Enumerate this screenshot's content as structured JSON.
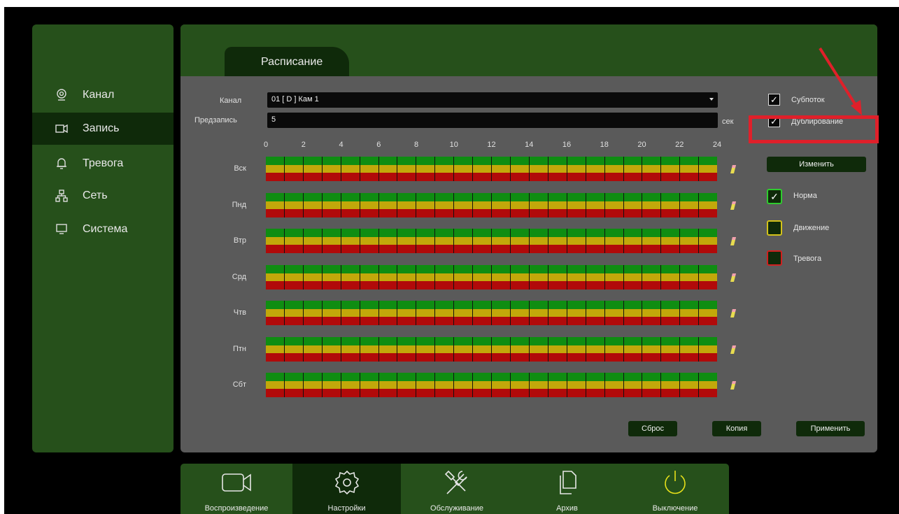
{
  "sidebar": {
    "items": [
      {
        "label": "Канал",
        "icon": "camera-lens-icon"
      },
      {
        "label": "Запись",
        "icon": "video-camera-icon",
        "active": true
      },
      {
        "label": "Тревога",
        "icon": "bell-icon"
      },
      {
        "label": "Сеть",
        "icon": "network-icon"
      },
      {
        "label": "Система",
        "icon": "monitor-icon"
      }
    ]
  },
  "tab": {
    "label": "Расписание"
  },
  "form": {
    "channel_label": "Канал",
    "channel_value": "01 [ D ] Кам 1",
    "prerecord_label": "Предзапись",
    "prerecord_value": "5",
    "prerecord_unit": "сек"
  },
  "schedule": {
    "hours": [
      "0",
      "2",
      "4",
      "6",
      "8",
      "10",
      "12",
      "14",
      "16",
      "18",
      "20",
      "22",
      "24"
    ],
    "days": [
      "Вск",
      "Пнд",
      "Втр",
      "Срд",
      "Чтв",
      "Птн",
      "Сбт"
    ],
    "bands": [
      {
        "name": "Норма",
        "color": "#0f8d12"
      },
      {
        "name": "Движение",
        "color": "#c2a80a"
      },
      {
        "name": "Тревога",
        "color": "#b10a0a"
      }
    ]
  },
  "options": {
    "substream_label": "Субпоток",
    "substream_checked": true,
    "duplicate_label": "Дублирование",
    "duplicate_checked": true
  },
  "edit_button": "Изменить",
  "legend": [
    {
      "label": "Норма",
      "border": "#2ecc2e",
      "checked": true
    },
    {
      "label": "Движение",
      "border": "#d4c21a",
      "checked": false
    },
    {
      "label": "Тревога",
      "border": "#d02020",
      "checked": false
    }
  ],
  "buttons": {
    "reset": "Сброс",
    "copy": "Копия",
    "apply": "Применить"
  },
  "dock": [
    {
      "label": "Воспроизведение",
      "icon": "video-camera-icon"
    },
    {
      "label": "Настройки",
      "icon": "gear-icon",
      "active": true
    },
    {
      "label": "Обслуживание",
      "icon": "tools-icon"
    },
    {
      "label": "Архив",
      "icon": "files-icon"
    },
    {
      "label": "Выключение",
      "icon": "power-icon"
    }
  ],
  "colors": {
    "accent": "#26501b",
    "active": "#0f2a0a",
    "annotation": "#e0202a"
  }
}
